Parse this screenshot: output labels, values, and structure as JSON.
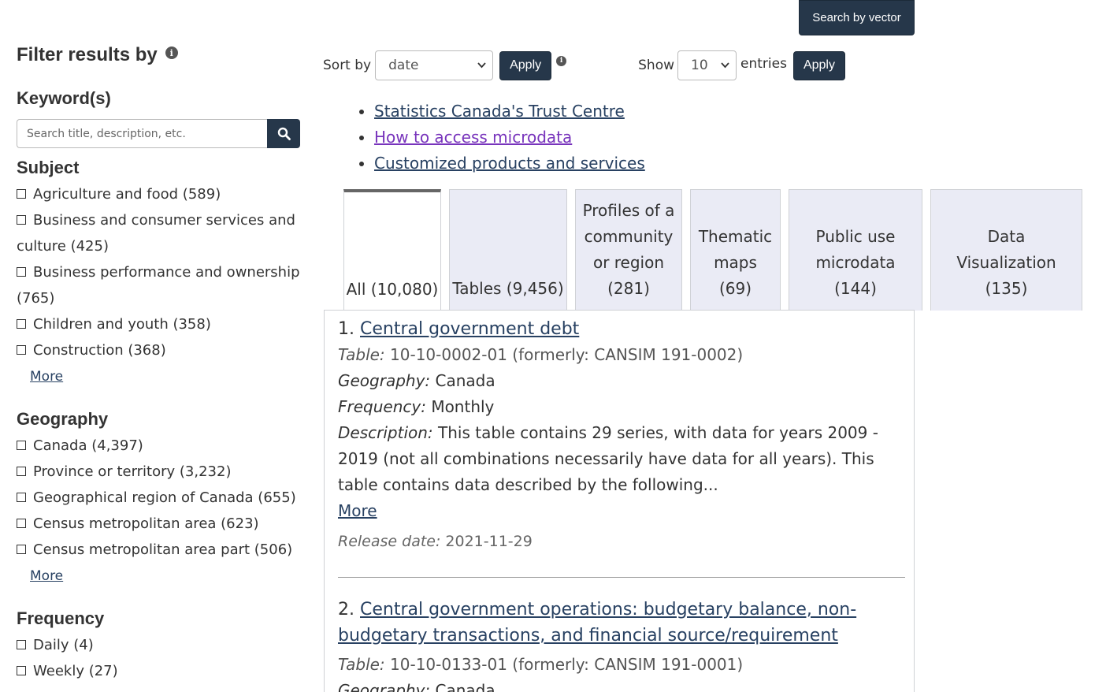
{
  "top": {
    "search_vector_label": "Search by vector"
  },
  "sidebar": {
    "title": "Filter results by",
    "info_icon": "i",
    "keyword_heading": "Keyword(s)",
    "search_placeholder": "Search title, description, etc.",
    "subject": {
      "heading": "Subject",
      "items": [
        "Agriculture and food (589)",
        "Business and consumer services and culture (425)",
        "Business performance and ownership (765)",
        "Children and youth (358)",
        "Construction (368)"
      ],
      "more": "More"
    },
    "geography": {
      "heading": "Geography",
      "items": [
        "Canada (4,397)",
        "Province or territory (3,232)",
        "Geographical region of Canada (655)",
        "Census metropolitan area (623)",
        "Census metropolitan area part (506)"
      ],
      "more": "More"
    },
    "frequency": {
      "heading": "Frequency",
      "items": [
        "Daily (4)",
        "Weekly (27)"
      ]
    }
  },
  "sort": {
    "sort_label": "Sort by",
    "sort_value": "date",
    "apply": "Apply",
    "show_label": "Show",
    "show_value": "10",
    "entries_label": "entries",
    "apply2": "Apply"
  },
  "links": [
    "Statistics Canada's Trust Centre",
    "How to access microdata",
    "Customized products and services"
  ],
  "tabs": [
    "All (10,080)",
    "Tables (9,456)",
    "Profiles of a community or region (281)",
    "Thematic maps (69)",
    "Public use microdata (144)",
    "Data Visualization (135)"
  ],
  "results": [
    {
      "num": "1.",
      "title": "Central government debt",
      "table_key": "Table:",
      "table_val": "10-10-0002-01 (formerly: CANSIM 191-0002)",
      "geo_key": "Geography:",
      "geo_val": "Canada",
      "freq_key": "Frequency:",
      "freq_val": "Monthly",
      "desc_key": "Description:",
      "desc_val": "This table contains 29 series, with data for years 2009 - 2019 (not all combinations necessarily have data for all years). This table contains data described by the following...",
      "more": "More",
      "release_key": "Release date:",
      "release_val": "2021-11-29"
    },
    {
      "num": "2.",
      "title": "Central government operations: budgetary balance, non-budgetary transactions, and financial source/requirement",
      "table_key": "Table:",
      "table_val": "10-10-0133-01 (formerly: CANSIM 191-0001)",
      "geo_key": "Geography:",
      "geo_val": "Canada"
    }
  ]
}
